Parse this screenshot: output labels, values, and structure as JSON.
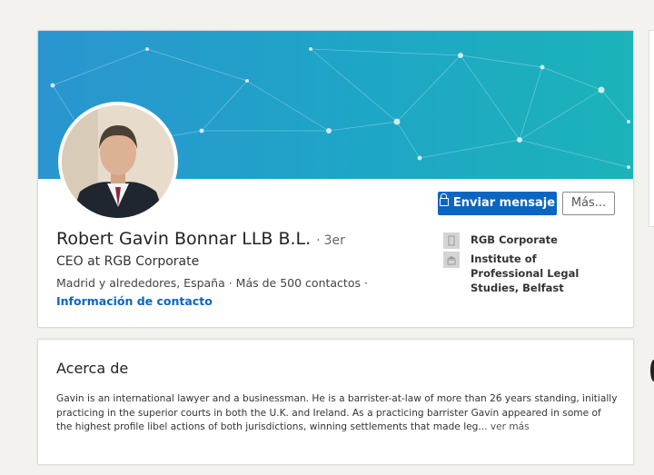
{
  "profile": {
    "name": "Robert Gavin Bonnar LLB B.L.",
    "degree_separator": "·",
    "degree": "3er",
    "headline": "CEO at RGB Corporate",
    "location_line": "Madrid y alrededores, España  ·  Más de 500 contactos  ·",
    "contact_info_label": "Información de contacto",
    "send_message_label": "Enviar mensaje",
    "more_label": "Más...",
    "organizations": [
      {
        "name": "RGB Corporate",
        "icon": "building-icon"
      },
      {
        "name": "Institute of Professional Legal Studies, Belfast",
        "icon": "school-icon"
      }
    ]
  },
  "about": {
    "title": "Acerca de",
    "text": "Gavin is an international lawyer and a businessman. He is a barrister-at-law of more than 26 years standing, initially practicing in the superior courts in both the U.K. and Ireland. As a practicing barrister Gavin appeared in some of the highest profile libel actions of both jurisdictions, winning settlements that made leg...",
    "see_more_label": " ver más"
  },
  "colors": {
    "accent": "#0a66c2",
    "banner_start": "#2a95d0",
    "banner_end": "#1cb3b9",
    "background": "#f3f2ef"
  }
}
